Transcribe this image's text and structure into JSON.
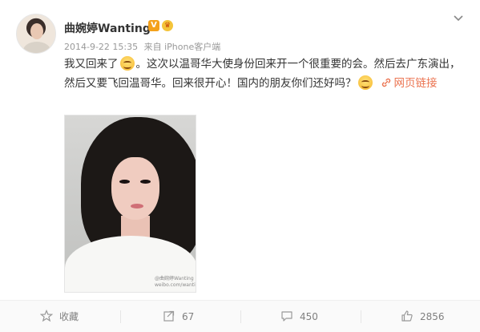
{
  "post": {
    "author": "曲婉婷Wanting",
    "verified_badge": "V",
    "timestamp": "2014-9-22 15:35",
    "source": "来自 iPhone客户端",
    "text_line1": "我又回来了",
    "text_line2": "。这次以温哥华大使身份回来开一个很重要的会。然后去广东演出，然后又要飞回温哥华。回来很开心！国内的朋友你们还好吗？",
    "link_label": "网页链接",
    "image_watermark_line1": "@曲婉婷Wanting",
    "image_watermark_line2": "weibo.com/wanting"
  },
  "actions": {
    "favorite_label": "收藏",
    "repost_count": "67",
    "comment_count": "450",
    "like_count": "2856"
  },
  "colors": {
    "link": "#eb7350",
    "verified": "#f4a11b",
    "muted": "#808080"
  },
  "icons": [
    "chevron-down-icon",
    "smile-emoji-icon",
    "link-icon",
    "star-icon",
    "repost-icon",
    "comment-icon",
    "thumbs-up-icon",
    "crown-icon"
  ]
}
